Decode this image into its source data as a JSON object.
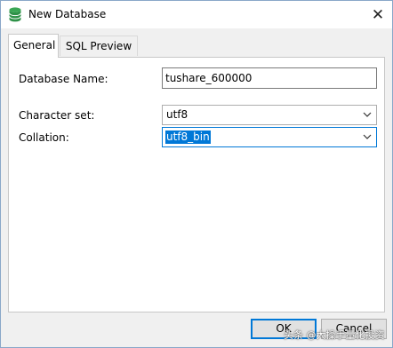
{
  "window": {
    "title": "New Database",
    "icon": "database-icon",
    "close_glyph": "✕"
  },
  "tabs": [
    {
      "label": "General",
      "active": true
    },
    {
      "label": "SQL Preview",
      "active": false
    }
  ],
  "form": {
    "database_name": {
      "label": "Database Name:",
      "value": "tushare_600000"
    },
    "character_set": {
      "label": "Character set:",
      "value": "utf8"
    },
    "collation": {
      "label": "Collation:",
      "value": "utf8_bin"
    }
  },
  "buttons": {
    "ok": "OK",
    "cancel": "Cancel"
  },
  "watermark": "头条 @大操手量化投资",
  "colors": {
    "accent": "#0078d7",
    "icon_green": "#3aa655"
  }
}
